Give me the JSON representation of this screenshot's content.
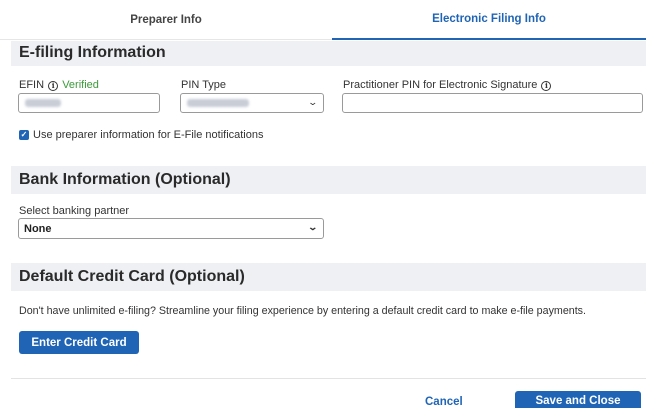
{
  "tabs": [
    {
      "label": "Preparer Info",
      "active": false
    },
    {
      "label": "Electronic Filing Info",
      "active": true
    }
  ],
  "efiling": {
    "title": "E-filing Information",
    "efin_label": "EFIN",
    "efin_status": "Verified",
    "pin_type_label": "PIN Type",
    "practitioner_pin_label": "Practitioner PIN for Electronic Signature",
    "practitioner_pin_value": "",
    "use_preparer_checkbox_label": "Use preparer information for E-File notifications",
    "use_preparer_checked": true
  },
  "bank": {
    "title": "Bank Information (Optional)",
    "select_label": "Select banking partner",
    "selected": "None"
  },
  "card": {
    "title": "Default Credit Card (Optional)",
    "description": "Don't have unlimited e-filing? Streamline your filing experience by entering a default credit card to make e-file payments.",
    "button_label": "Enter Credit Card"
  },
  "footer": {
    "cancel_label": "Cancel",
    "save_label": "Save and Close"
  },
  "colors": {
    "accent": "#1f64b5",
    "verified": "#3b9a3b",
    "section_bg": "#eef0f4"
  },
  "icons": {
    "info": "info-circle-icon",
    "dropdown": "chevron-down-icon",
    "checkbox": "checkmark-icon"
  }
}
